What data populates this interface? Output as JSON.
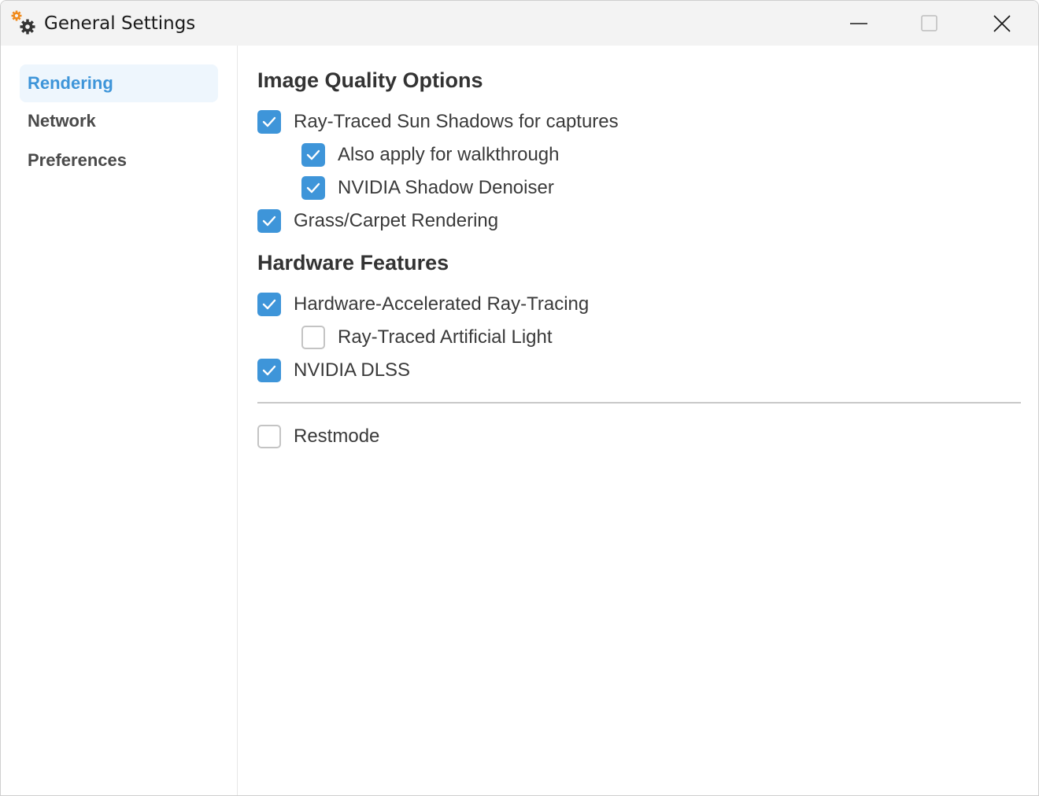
{
  "window": {
    "title": "General Settings"
  },
  "sidebar": {
    "items": [
      {
        "label": "Rendering",
        "active": true
      },
      {
        "label": "Network"
      },
      {
        "label": "Preferences"
      }
    ]
  },
  "main": {
    "sections": [
      {
        "title": "Image Quality Options",
        "options": [
          {
            "label": "Ray-Traced Sun Shadows for captures",
            "checked": true
          },
          {
            "label": "Also apply for walkthrough",
            "checked": true,
            "nested": true
          },
          {
            "label": "NVIDIA Shadow Denoiser",
            "checked": true,
            "nested": true
          },
          {
            "label": "Grass/Carpet Rendering",
            "checked": true
          }
        ]
      },
      {
        "title": "Hardware Features",
        "options": [
          {
            "label": "Hardware-Accelerated Ray-Tracing",
            "checked": true
          },
          {
            "label": "Ray-Traced Artificial Light",
            "checked": false,
            "nested": true
          },
          {
            "label": "NVIDIA DLSS",
            "checked": true
          }
        ]
      }
    ],
    "extra_option": {
      "label": "Restmode",
      "checked": false
    }
  },
  "colors": {
    "accent": "#3e95d9",
    "active_nav_bg": "#eef6fd",
    "titlebar_bg": "#f3f3f3"
  },
  "icons": {
    "app": "gears-icon",
    "minimize": "minimize-icon",
    "maximize": "maximize-icon",
    "close": "close-icon",
    "check": "checkmark-icon"
  }
}
